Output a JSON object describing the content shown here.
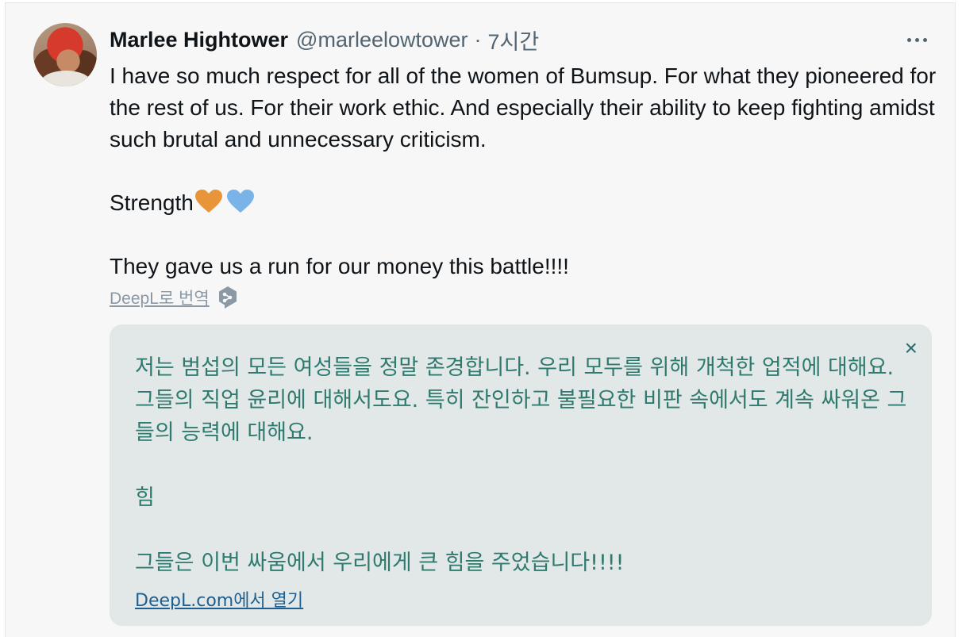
{
  "tweet": {
    "author_name": "Marlee Hightower",
    "author_handle": "@marleelowtower",
    "separator": "·",
    "timestamp": "7시간",
    "more_icon": "ellipsis-icon",
    "text": {
      "line_1": "I have so much respect for all of the women of Bumsup. For what they pioneered for the rest of us. For their work ethic. And especially their ability to keep fighting amidst such brutal and unnecessary criticism.",
      "line_2": "Strength",
      "line_3": "They gave us a run for our money this battle!!!!"
    },
    "emoji": [
      {
        "name": "orange-heart-icon",
        "color": "#e8953a"
      },
      {
        "name": "blue-heart-icon",
        "color": "#7ab3e8"
      }
    ]
  },
  "translate": {
    "link_label": "DeepL로 번역",
    "badge_icon": "deepl-logo-icon"
  },
  "translation": {
    "close_icon": "close-icon",
    "close_glyph": "×",
    "paragraph_1": "저는 범섭의 모든 여성들을 정말 존경합니다. 우리 모두를 위해 개척한 업적에 대해요. 그들의 직업 윤리에 대해서도요. 특히 잔인하고 불필요한 비판 속에서도 계속 싸워온 그들의 능력에 대해요.",
    "paragraph_2": "힘",
    "paragraph_3": "그들은 이번 싸움에서 우리에게 큰 힘을 주었습니다!!!!",
    "open_link": "DeepL.com에서 열기"
  },
  "colors": {
    "background": "#f7f7f7",
    "text": "#0f1419",
    "secondary_text": "#536471",
    "translation_bg": "#e2e8e8",
    "translation_text": "#2f7a6f",
    "link": "#1f5f8f"
  }
}
